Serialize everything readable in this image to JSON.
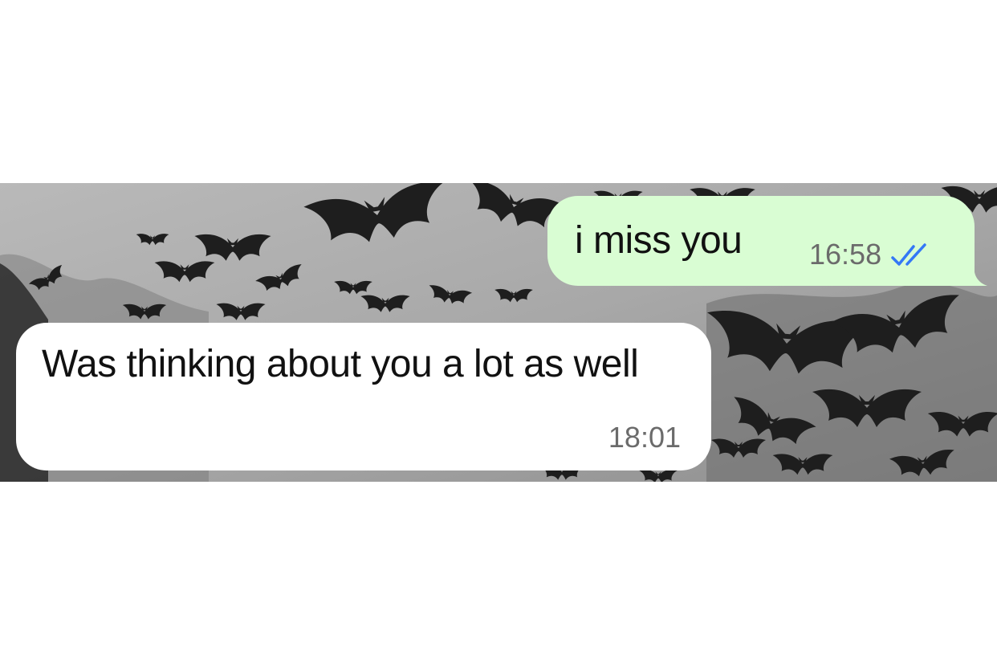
{
  "conversation": {
    "messages": [
      {
        "direction": "outgoing",
        "text": "i miss you",
        "time": "16:58",
        "status_icon": "double-check-read-icon",
        "status_color": "#3478f6",
        "bubble_color": "#d9fdd3"
      },
      {
        "direction": "incoming",
        "text": "Was thinking about you a lot as well",
        "time": "18:01",
        "bubble_color": "#ffffff"
      }
    ],
    "wallpaper": "bats-wallpaper"
  }
}
